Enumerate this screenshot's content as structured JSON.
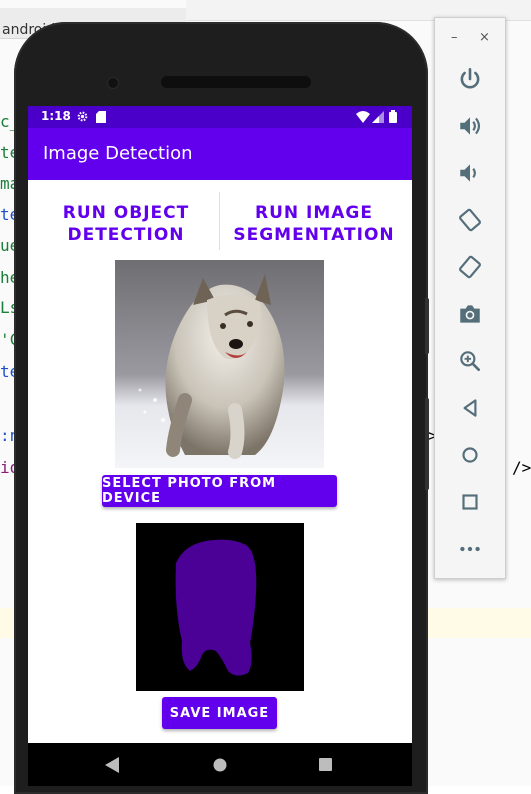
{
  "ide": {
    "tab_title": "android:layout_width",
    "code_fragments": [
      "c_",
      "te",
      "ma",
      "te",
      "ue",
      "he",
      "Ls",
      "'C",
      "te",
      ":n",
      "io"
    ],
    "right_fragments": [
      ">",
      "/>"
    ]
  },
  "status_bar": {
    "time": "1:18"
  },
  "app_bar": {
    "title": "Image Detection"
  },
  "buttons": {
    "object_detection": "RUN OBJECT DETECTION",
    "image_segmentation": "RUN IMAGE SEGMENTATION",
    "select_photo": "SELECT PHOTO FROM DEVICE",
    "save_image": "SAVE IMAGE"
  },
  "emulator": {
    "minimize": "–",
    "close": "×"
  },
  "colors": {
    "primary": "#6200ee",
    "status_bar": "#4b00c9",
    "segment": "#4b0096"
  }
}
